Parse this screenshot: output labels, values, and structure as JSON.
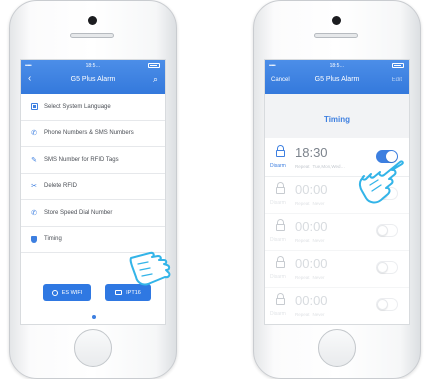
{
  "left_screen": {
    "status": {
      "signal": "•••••",
      "time": "18:5…"
    },
    "nav": {
      "back_icon": "chevron-left-icon",
      "title": "G5 Plus Alarm",
      "search_icon": "search-icon"
    },
    "menu": [
      {
        "label": "Select System Language",
        "icon": "language-icon"
      },
      {
        "label": "Phone Numbers & SMS Numbers",
        "icon": "phone-icon"
      },
      {
        "label": "SMS Number for RFID Tags",
        "icon": "rfid-icon"
      },
      {
        "label": "Delete RFID",
        "icon": "delete-rfid-icon"
      },
      {
        "label": "Store Speed Dial Number",
        "icon": "speed-dial-icon"
      },
      {
        "label": "Timing",
        "icon": "timing-icon"
      }
    ],
    "buttons": {
      "es_wifi": "ES WIFI",
      "ipt": "IPT16"
    }
  },
  "right_screen": {
    "status": {
      "signal": "•••••",
      "time": "18:5…"
    },
    "nav": {
      "cancel": "Cancel",
      "title": "G5 Plus Alarm",
      "edit": "Edit"
    },
    "title": "Timing",
    "timers": [
      {
        "mode": "Disarm",
        "time": "18:30",
        "repeat_label": "Repeat",
        "repeat_value": "Tue,Mon,Wed…",
        "enabled": true
      },
      {
        "mode": "Disarm",
        "time": "00:00",
        "repeat_label": "Repeat",
        "repeat_value": "Never",
        "enabled": false
      },
      {
        "mode": "Disarm",
        "time": "00:00",
        "repeat_label": "Repeat",
        "repeat_value": "Never",
        "enabled": false
      },
      {
        "mode": "Disarm",
        "time": "00:00",
        "repeat_label": "Repeat",
        "repeat_value": "Never",
        "enabled": false
      },
      {
        "mode": "Disarm",
        "time": "00:00",
        "repeat_label": "Repeat",
        "repeat_value": "Never",
        "enabled": false
      }
    ]
  },
  "colors": {
    "accent": "#3d7fe0",
    "nav_bar": "#3479dc",
    "hand_fill": "#ffffff",
    "hand_stroke": "#33b4e8"
  }
}
